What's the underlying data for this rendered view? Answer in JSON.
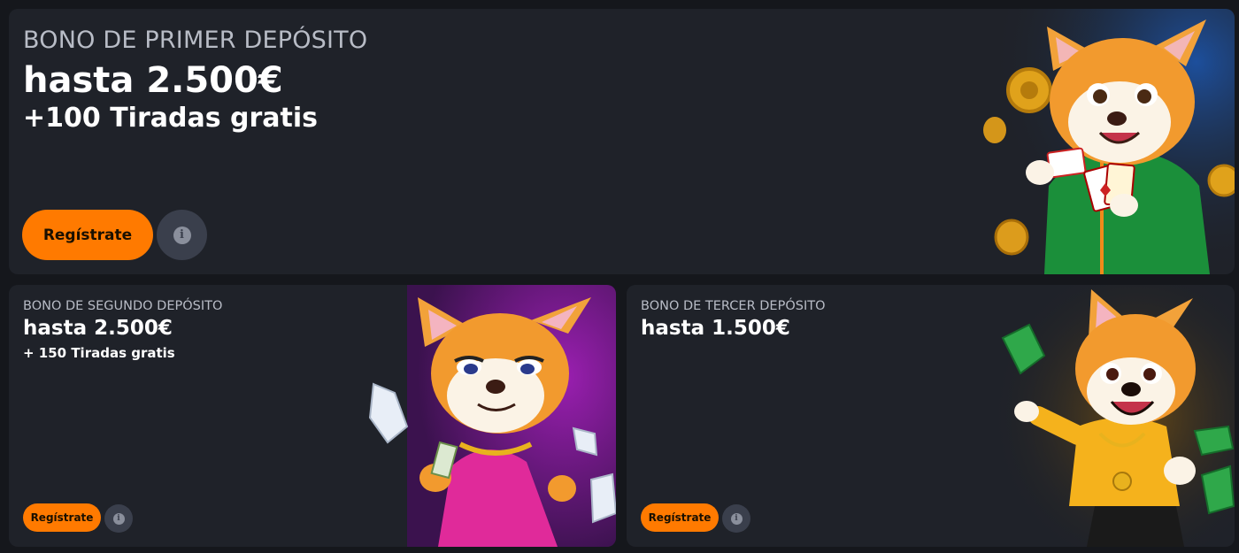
{
  "promos": [
    {
      "subtitle": "BONO DE PRIMER DEPÓSITO",
      "amount": "hasta 2.500€",
      "spins": "+100 Tiradas gratis",
      "button_label": "Regístrate",
      "info_icon": "info-icon",
      "mascot": "corgi-green-hoodie-cards"
    },
    {
      "subtitle": "BONO DE SEGUNDO DEPÓSITO",
      "amount": "hasta 2.500€",
      "spins": "+ 150 Tiradas gratis",
      "button_label": "Regístrate",
      "info_icon": "info-icon",
      "mascot": "fox-pink-dress-diamonds"
    },
    {
      "subtitle": "BONO DE TERCER DEPÓSITO",
      "amount": "hasta 1.500€",
      "button_label": "Regístrate",
      "info_icon": "info-icon",
      "mascot": "shiba-yellow-shirt-money"
    }
  ],
  "colors": {
    "page_bg": "#15171c",
    "card_bg": "#1f2229",
    "accent": "#ff7a00",
    "info_bg": "#3a3f4c"
  }
}
